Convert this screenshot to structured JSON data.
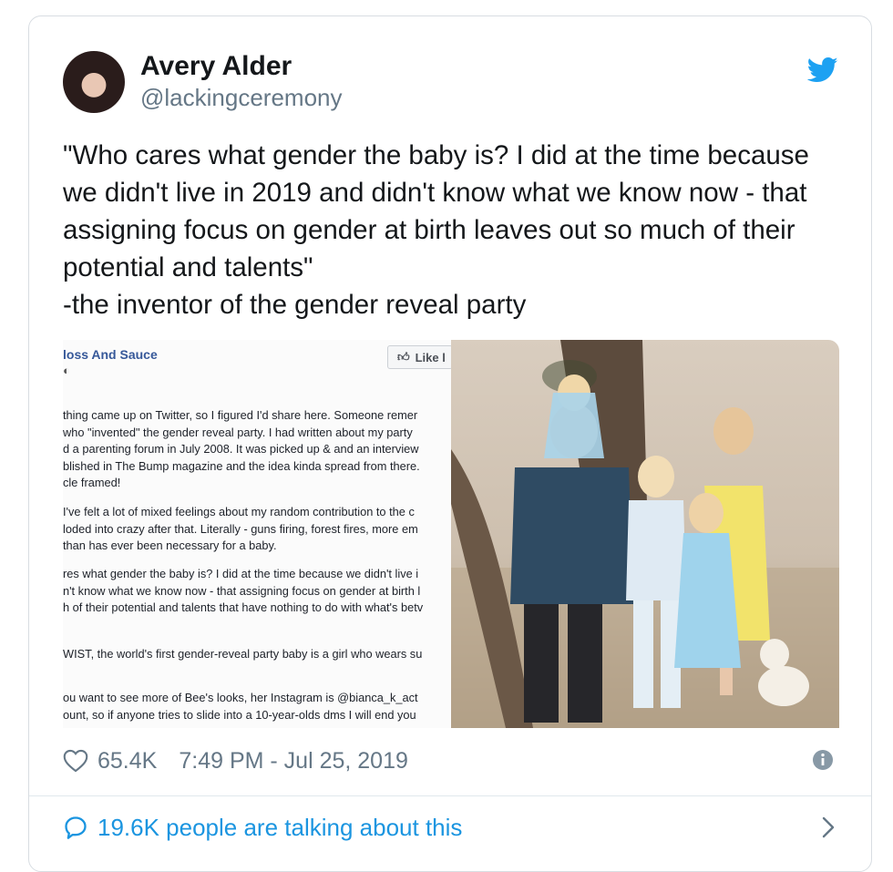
{
  "author": {
    "display_name": "Avery Alder",
    "handle": "@lackingceremony"
  },
  "tweet": {
    "lines": [
      "\"Who cares what gender the baby is? I did at the time because",
      "we didn't live in 2019 and didn't know what we know now - that",
      "assigning focus on gender at birth leaves out so much of their",
      "potential and talents\"",
      "-the inventor of the gender reveal party"
    ]
  },
  "embedded_post": {
    "page_name": "loss And Sauce",
    "like_label": "Like l",
    "paragraphs": [
      [
        "thing came up on Twitter, so I figured I'd share here. Someone remer",
        "who \"invented\" the gender reveal party. I had written about my party",
        "d a parenting forum in July 2008. It was picked up & and an interview",
        "blished in The Bump magazine and the idea kinda spread from there.",
        "cle framed!"
      ],
      [
        "I've felt a lot of mixed feelings about my random contribution to the c",
        "loded into crazy after that. Literally - guns firing, forest fires, more em",
        "than has ever been necessary for a baby."
      ],
      [
        "res what gender the baby is? I did at the time because we didn't live i",
        "n't know what we know now - that assigning focus on gender at birth l",
        "h of their potential and talents that have nothing to do with what's betv"
      ],
      [
        "WIST, the world's first gender-reveal party baby is a girl who wears su"
      ],
      [
        "ou want to see more of Bee's looks, her Instagram is @bianca_k_act",
        "ount, so if anyone tries to slide into a 10-year-olds dms I will end you"
      ]
    ]
  },
  "stats": {
    "likes": "65.4K",
    "timestamp": "7:49 PM - Jul 25, 2019"
  },
  "conversation": {
    "label": "19.6K people are talking about this"
  },
  "colors": {
    "twitter_blue": "#1da1f2",
    "link_blue": "#1b95e0",
    "muted": "#657786"
  }
}
